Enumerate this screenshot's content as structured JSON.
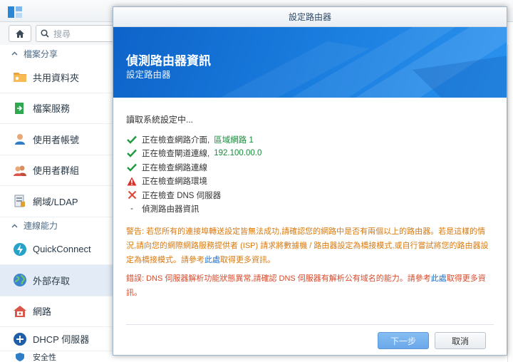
{
  "search": {
    "placeholder": "搜尋"
  },
  "sidebar": {
    "groups": [
      {
        "label": "檔案分享"
      },
      {
        "label": "連線能力"
      }
    ],
    "items": [
      {
        "label": "共用資料夾",
        "icon": "folder-share-icon"
      },
      {
        "label": "檔案服務",
        "icon": "file-service-icon"
      },
      {
        "label": "使用者帳號",
        "icon": "user-icon"
      },
      {
        "label": "使用者群組",
        "icon": "user-group-icon"
      },
      {
        "label": "網域/LDAP",
        "icon": "domain-icon"
      },
      {
        "label": "QuickConnect",
        "icon": "quickconnect-icon"
      },
      {
        "label": "外部存取",
        "icon": "globe-icon"
      },
      {
        "label": "網路",
        "icon": "network-icon"
      },
      {
        "label": "DHCP 伺服器",
        "icon": "dhcp-icon"
      },
      {
        "label": "安全性",
        "icon": "security-icon"
      }
    ]
  },
  "dialog": {
    "title": "設定路由器",
    "header_title": "偵測路由器資訊",
    "header_subtitle": "設定路由器",
    "reading": "讀取系統設定中...",
    "checks": [
      {
        "status": "ok",
        "text": "正在檢查網路介面,",
        "value": "區域網路 1"
      },
      {
        "status": "ok",
        "text": "正在檢查閘道連線,",
        "value": "192.100.00.0"
      },
      {
        "status": "ok",
        "text": "正在檢查網路連線",
        "value": ""
      },
      {
        "status": "warning",
        "text": "正在檢查網路環境",
        "value": ""
      },
      {
        "status": "error",
        "text": "正在檢查 DNS 伺服器",
        "value": ""
      },
      {
        "status": "pending",
        "text": "偵測路由器資訊",
        "value": ""
      }
    ],
    "warning": {
      "text": "警告: 若您所有的連接埠轉送設定皆無法成功,請確認您的網路中是否有兩個以上的路由器。若是這樣的情況,請向您的網際網路服務提供者 (ISP) 請求將數據機 / 路由器設定為橋接模式,或自行嘗試將您的路由器設定為橋接模式。請參考",
      "link": "此處",
      "tail": "取得更多資訊。"
    },
    "error": {
      "text": "錯誤: DNS 伺服器解析功能狀態異常,請確認 DNS 伺服器有解析公有域名的能力。請參考",
      "link": "此處",
      "tail": "取得更多資訊。"
    },
    "next_label": "下一步",
    "cancel_label": "取消"
  },
  "colors": {
    "accent": "#1b7fe0",
    "ok": "#1f9a3f",
    "warning": "#d9322b",
    "error": "#e04a3a",
    "warning_text": "#d87a10",
    "error_text": "#d84a2a",
    "link": "#1a6fce"
  }
}
